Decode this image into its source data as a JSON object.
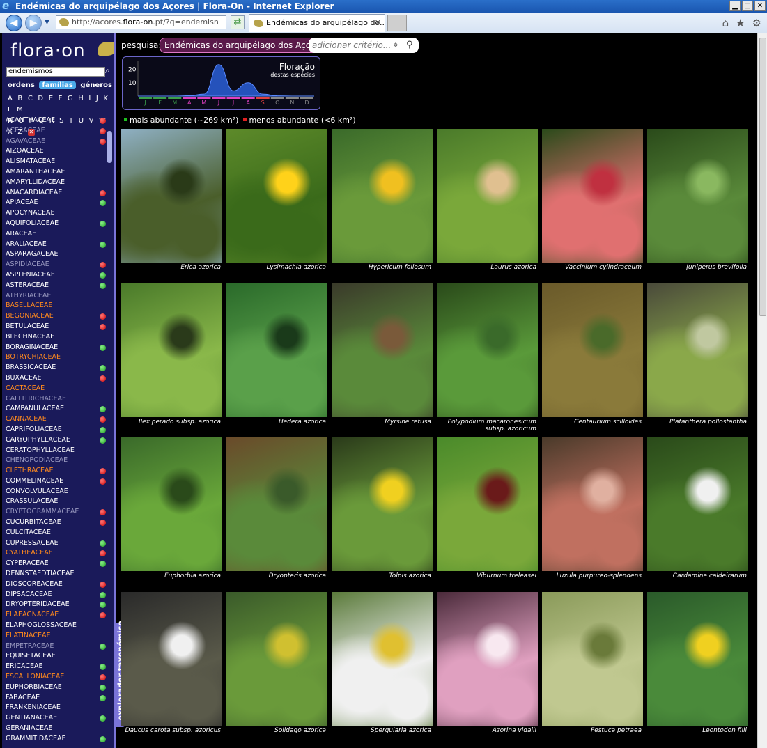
{
  "window": {
    "title": "Endémicas do arquipélago dos Açores | Flora-On - Internet Explorer"
  },
  "browser": {
    "address_host": "acores.",
    "address_domain": "flora-on",
    "address_rest": ".pt/?q=endemisn",
    "address_prefix": "http://",
    "tab_title": "Endémicas do arquipélago do...",
    "tab_close": "✕"
  },
  "sidebar": {
    "logo": "flora·on",
    "search_value": "endemismos",
    "toggles": [
      "ordens",
      "famílias",
      "géneros"
    ],
    "letters_row1": "A B C D E F G H I J K L M",
    "letters_row2": "N O P Q R S T U V W X Z",
    "explorer_label": "explorador taxonómico",
    "families": [
      {
        "name": "ACANTHACEAE",
        "tone": "white",
        "dot": "red"
      },
      {
        "name": "ACERACEAE",
        "tone": "gray",
        "dot": "red"
      },
      {
        "name": "AGAVACEAE",
        "tone": "gray",
        "dot": "red"
      },
      {
        "name": "AIZOACEAE",
        "tone": "white",
        "dot": ""
      },
      {
        "name": "ALISMATACEAE",
        "tone": "white",
        "dot": ""
      },
      {
        "name": "AMARANTHACEAE",
        "tone": "white",
        "dot": ""
      },
      {
        "name": "AMARYLLIDACEAE",
        "tone": "white",
        "dot": ""
      },
      {
        "name": "ANACARDIACEAE",
        "tone": "white",
        "dot": "red"
      },
      {
        "name": "APIACEAE",
        "tone": "white",
        "dot": "green"
      },
      {
        "name": "APOCYNACEAE",
        "tone": "white",
        "dot": ""
      },
      {
        "name": "AQUIFOLIACEAE",
        "tone": "white",
        "dot": "green"
      },
      {
        "name": "ARACEAE",
        "tone": "white",
        "dot": ""
      },
      {
        "name": "ARALIACEAE",
        "tone": "white",
        "dot": "green"
      },
      {
        "name": "ASPARAGACEAE",
        "tone": "white",
        "dot": ""
      },
      {
        "name": "ASPIDIACEAE",
        "tone": "gray",
        "dot": "red"
      },
      {
        "name": "ASPLENIACEAE",
        "tone": "white",
        "dot": "green"
      },
      {
        "name": "ASTERACEAE",
        "tone": "white",
        "dot": "green"
      },
      {
        "name": "ATHYRIACEAE",
        "tone": "gray",
        "dot": ""
      },
      {
        "name": "BASELLACEAE",
        "tone": "orange",
        "dot": ""
      },
      {
        "name": "BEGONIACEAE",
        "tone": "orange",
        "dot": "red"
      },
      {
        "name": "BETULACEAE",
        "tone": "white",
        "dot": "red"
      },
      {
        "name": "BLECHNACEAE",
        "tone": "white",
        "dot": ""
      },
      {
        "name": "BORAGINACEAE",
        "tone": "white",
        "dot": "green"
      },
      {
        "name": "BOTRYCHIACEAE",
        "tone": "orange",
        "dot": ""
      },
      {
        "name": "BRASSICACEAE",
        "tone": "white",
        "dot": "green"
      },
      {
        "name": "BUXACEAE",
        "tone": "white",
        "dot": "red"
      },
      {
        "name": "CACTACEAE",
        "tone": "orange",
        "dot": ""
      },
      {
        "name": "CALLITRICHACEAE",
        "tone": "gray",
        "dot": ""
      },
      {
        "name": "CAMPANULACEAE",
        "tone": "white",
        "dot": "green"
      },
      {
        "name": "CANNACEAE",
        "tone": "orange",
        "dot": "red"
      },
      {
        "name": "CAPRIFOLIACEAE",
        "tone": "white",
        "dot": "green"
      },
      {
        "name": "CARYOPHYLLACEAE",
        "tone": "white",
        "dot": "green"
      },
      {
        "name": "CERATOPHYLLACEAE",
        "tone": "white",
        "dot": ""
      },
      {
        "name": "CHENOPODIACEAE",
        "tone": "gray",
        "dot": ""
      },
      {
        "name": "CLETHRACEAE",
        "tone": "orange",
        "dot": "red"
      },
      {
        "name": "COMMELINACEAE",
        "tone": "white",
        "dot": "red"
      },
      {
        "name": "CONVOLVULACEAE",
        "tone": "white",
        "dot": ""
      },
      {
        "name": "CRASSULACEAE",
        "tone": "white",
        "dot": ""
      },
      {
        "name": "CRYPTOGRAMMACEAE",
        "tone": "gray",
        "dot": "red"
      },
      {
        "name": "CUCURBITACEAE",
        "tone": "white",
        "dot": "red"
      },
      {
        "name": "CULCITACEAE",
        "tone": "white",
        "dot": ""
      },
      {
        "name": "CUPRESSACEAE",
        "tone": "white",
        "dot": "green"
      },
      {
        "name": "CYATHEACEAE",
        "tone": "orange",
        "dot": "red"
      },
      {
        "name": "CYPERACEAE",
        "tone": "white",
        "dot": "green"
      },
      {
        "name": "DENNSTAEDTIACEAE",
        "tone": "white",
        "dot": ""
      },
      {
        "name": "DIOSCOREACEAE",
        "tone": "white",
        "dot": "red"
      },
      {
        "name": "DIPSACACEAE",
        "tone": "white",
        "dot": "green"
      },
      {
        "name": "DRYOPTERIDACEAE",
        "tone": "white",
        "dot": "green"
      },
      {
        "name": "ELAEAGNACEAE",
        "tone": "orange",
        "dot": "red"
      },
      {
        "name": "ELAPHOGLOSSACEAE",
        "tone": "white",
        "dot": ""
      },
      {
        "name": "ELATINACEAE",
        "tone": "orange",
        "dot": ""
      },
      {
        "name": "EMPETRACEAE",
        "tone": "gray",
        "dot": "green"
      },
      {
        "name": "EQUISETACEAE",
        "tone": "white",
        "dot": ""
      },
      {
        "name": "ERICACEAE",
        "tone": "white",
        "dot": "green"
      },
      {
        "name": "ESCALLONIACEAE",
        "tone": "orange",
        "dot": "red"
      },
      {
        "name": "EUPHORBIACEAE",
        "tone": "white",
        "dot": "green"
      },
      {
        "name": "FABACEAE",
        "tone": "white",
        "dot": "green"
      },
      {
        "name": "FRANKENIACEAE",
        "tone": "white",
        "dot": ""
      },
      {
        "name": "GENTIANACEAE",
        "tone": "white",
        "dot": "green"
      },
      {
        "name": "GERANIACEAE",
        "tone": "white",
        "dot": ""
      },
      {
        "name": "GRAMMITIDACEAE",
        "tone": "white",
        "dot": "green"
      }
    ]
  },
  "search": {
    "label": "pesquisa:",
    "criterion": "Endémicas do arquipélago dos Açores",
    "add_placeholder": "adicionar critério..."
  },
  "flowering": {
    "title": "Floração",
    "subtitle": "destas espécies",
    "months": [
      "J",
      "F",
      "M",
      "A",
      "M",
      "J",
      "J",
      "A",
      "S",
      "O",
      "N",
      "D"
    ],
    "month_colors": [
      "#3aa04a",
      "#3aa04a",
      "#3aa04a",
      "#e040c0",
      "#e040c0",
      "#e040c0",
      "#e040c0",
      "#e040c0",
      "#e04040",
      "#888888",
      "#888888",
      "#888888"
    ],
    "y_ticks": [
      10,
      20
    ],
    "curve": [
      0,
      0,
      0,
      0.3,
      1.5,
      23.5,
      4,
      10,
      1.5,
      0.2,
      0,
      0
    ]
  },
  "legend": {
    "most_label": "mais abundante (~269 km²)",
    "least_label": "menos abundante (<6 km²)",
    "most_color": "#1ec01e",
    "least_color": "#e02020"
  },
  "species": [
    {
      "name": "Erica azorica",
      "palette": [
        "#8fb0c4",
        "#4a5e2a",
        "#2a3a18"
      ]
    },
    {
      "name": "Lysimachia azorica",
      "palette": [
        "#5d8a2a",
        "#3a6a1a",
        "#ffd21a"
      ]
    },
    {
      "name": "Hypericum foliosum",
      "palette": [
        "#3a6a2a",
        "#6a9a3a",
        "#f0c020"
      ]
    },
    {
      "name": "Laurus azorica",
      "palette": [
        "#4a7a2a",
        "#7aa83a",
        "#e0c090"
      ]
    },
    {
      "name": "Vaccinium cylindraceum",
      "palette": [
        "#2a4a1a",
        "#e07070",
        "#c03040"
      ]
    },
    {
      "name": "Juniperus brevifolia",
      "palette": [
        "#2a4a1a",
        "#5a8a3a",
        "#8ab860"
      ]
    },
    {
      "name": "Ilex perado subsp. azorica",
      "palette": [
        "#4a7a2a",
        "#8ab84a",
        "#2a3a1a"
      ]
    },
    {
      "name": "Hedera azorica",
      "palette": [
        "#2a6a2a",
        "#5aa04a",
        "#1a3a1a"
      ]
    },
    {
      "name": "Myrsine retusa",
      "palette": [
        "#3a3a2a",
        "#5a8a3a",
        "#7a5a3a"
      ]
    },
    {
      "name": "Polypodium macaronesicum subsp. azoricum",
      "palette": [
        "#2a4a1a",
        "#5a9a3a",
        "#3a6a2a"
      ]
    },
    {
      "name": "Centaurium scilloides",
      "palette": [
        "#6a5a2a",
        "#8a7a3a",
        "#4a6a2a"
      ]
    },
    {
      "name": "Platanthera pollostantha",
      "palette": [
        "#4a4a3a",
        "#8aa84a",
        "#c0c8a0"
      ]
    },
    {
      "name": "Euphorbia azorica",
      "palette": [
        "#3a6a2a",
        "#6aa83a",
        "#2a4a1a"
      ]
    },
    {
      "name": "Dryopteris azorica",
      "palette": [
        "#6a4a2a",
        "#5a8a3a",
        "#3a5a2a"
      ]
    },
    {
      "name": "Tolpis azorica",
      "palette": [
        "#2a3a1a",
        "#6a9a3a",
        "#f0d020"
      ]
    },
    {
      "name": "Viburnum treleasei",
      "palette": [
        "#4a8a2a",
        "#7aa83a",
        "#6a1a1a"
      ]
    },
    {
      "name": "Luzula purpureo-splendens",
      "palette": [
        "#4a3a2a",
        "#c07060",
        "#e0b0a0"
      ]
    },
    {
      "name": "Cardamine caldeirarum",
      "palette": [
        "#2a4a1a",
        "#4a7a2a",
        "#f0f0f0"
      ]
    },
    {
      "name": "Daucus carota subsp. azoricus",
      "palette": [
        "#2a2a2a",
        "#5a5a4a",
        "#f0f0f0"
      ]
    },
    {
      "name": "Solidago azorica",
      "palette": [
        "#3a5a2a",
        "#6a9a3a",
        "#d0c030"
      ]
    },
    {
      "name": "Spergularia azorica",
      "palette": [
        "#5a7a3a",
        "#f0f0f0",
        "#e0c030"
      ]
    },
    {
      "name": "Azorina vidalii",
      "palette": [
        "#4a2a3a",
        "#e0a0c0",
        "#f8e8f0"
      ]
    },
    {
      "name": "Festuca petraea",
      "palette": [
        "#8a9a5a",
        "#c0c890",
        "#6a7a3a"
      ]
    },
    {
      "name": "Leontodon filii",
      "palette": [
        "#2a5a2a",
        "#4a8a3a",
        "#f0d020"
      ]
    }
  ]
}
